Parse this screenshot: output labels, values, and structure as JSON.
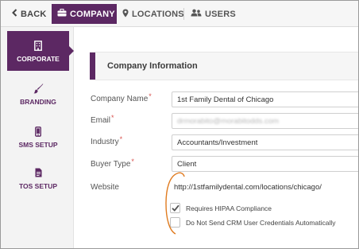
{
  "nav": {
    "back_label": "BACK",
    "company_label": "COMPANY",
    "locations_label": "LOCATIONS",
    "users_label": "USERS",
    "active_tab": "COMPANY"
  },
  "sidebar": {
    "items": [
      {
        "label": "CORPORATE",
        "icon": "building-icon",
        "active": true
      },
      {
        "label": "BRANDING",
        "icon": "brush-icon",
        "active": false
      },
      {
        "label": "SMS SETUP",
        "icon": "mobile-phone-icon",
        "active": false
      },
      {
        "label": "TOS SETUP",
        "icon": "document-icon",
        "active": false
      }
    ]
  },
  "section": {
    "title": "Company Information"
  },
  "form": {
    "company_name": {
      "label": "Company Name",
      "required": "*",
      "value": "1st Family Dental of Chicago"
    },
    "email": {
      "label": "Email",
      "required": "*",
      "value": "drmorabito@morabitodds.com"
    },
    "industry": {
      "label": "Industry",
      "required": "*",
      "value": "Accountants/Investment"
    },
    "buyer_type": {
      "label": "Buyer Type",
      "required": "*",
      "value": "Client"
    },
    "website": {
      "label": "Website",
      "value": "http://1stfamilydental.com/locations/chicago/"
    },
    "hipaa": {
      "label": "Requires HIPAA Compliance",
      "checked": true
    },
    "crm": {
      "label": "Do Not Send CRM User Credentials Automatically",
      "checked": false
    }
  },
  "colors": {
    "brand": "#5c2863",
    "annotation": "#e07b1f",
    "required": "#d9534f"
  }
}
